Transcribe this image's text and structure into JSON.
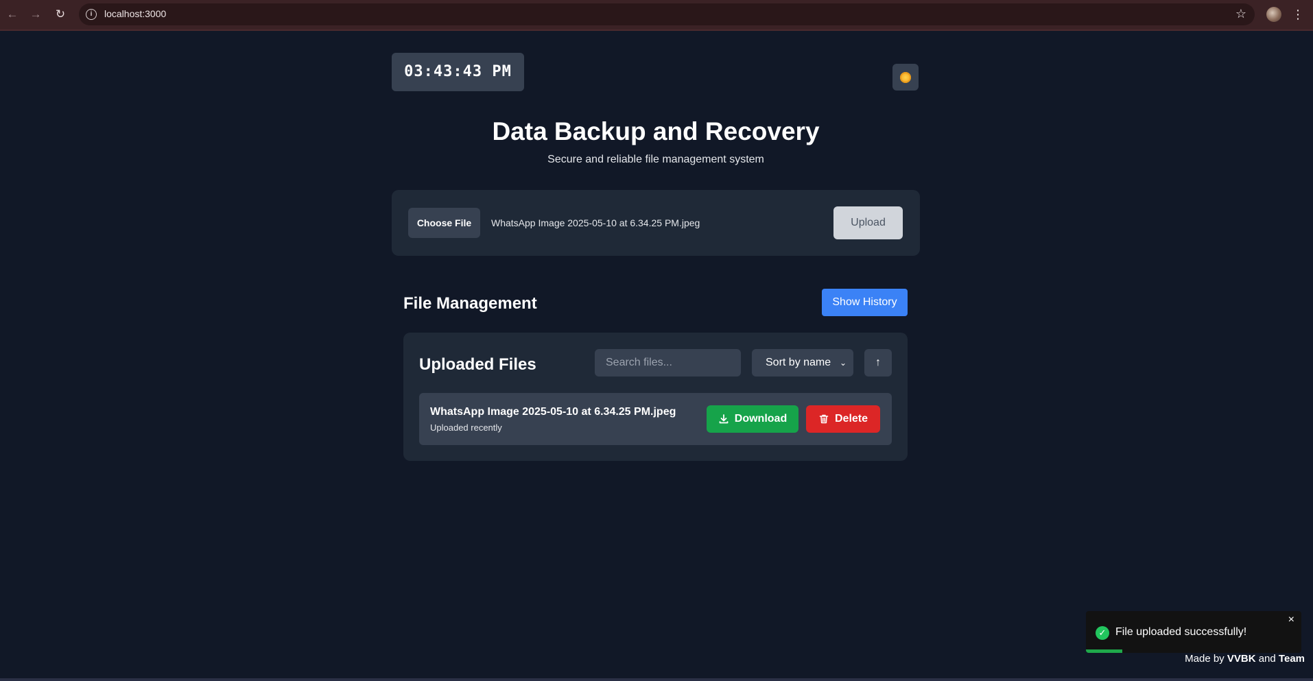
{
  "browser": {
    "url": "localhost:3000",
    "back_icon": "arrow-left-icon",
    "forward_icon": "arrow-right-icon",
    "reload_icon": "reload-icon",
    "info_icon": "info-icon",
    "bookmark_icon": "star-icon",
    "menu_icon": "more-vertical-icon"
  },
  "header": {
    "clock": "03:43:43 PM",
    "theme_icon": "sun-icon"
  },
  "hero": {
    "title": "Data Backup and Recovery",
    "subtitle": "Secure and reliable file management system"
  },
  "upload": {
    "choose_label": "Choose File",
    "selected_file": "WhatsApp Image 2025-05-10 at 6.34.25 PM.jpeg",
    "upload_label": "Upload"
  },
  "management": {
    "title": "File Management",
    "history_label": "Show History"
  },
  "files": {
    "title": "Uploaded Files",
    "search_placeholder": "Search files...",
    "sort_selected": "Sort by name",
    "sort_direction": "↑",
    "items": [
      {
        "name": "WhatsApp Image 2025-05-10 at 6.34.25 PM.jpeg",
        "status": "Uploaded recently",
        "download_label": "Download",
        "delete_label": "Delete"
      }
    ]
  },
  "toast": {
    "message": "File uploaded successfully!",
    "close": "×",
    "progress": 0.17,
    "color": "#1fa84a"
  },
  "footer": {
    "made_by": "Made by",
    "name1": "VVBK",
    "and": "and",
    "name2": "Team"
  },
  "colors": {
    "background": "#111827",
    "card": "#1f2937",
    "primary": "#3b82f6",
    "success": "#16a34a",
    "danger": "#dc2626"
  }
}
